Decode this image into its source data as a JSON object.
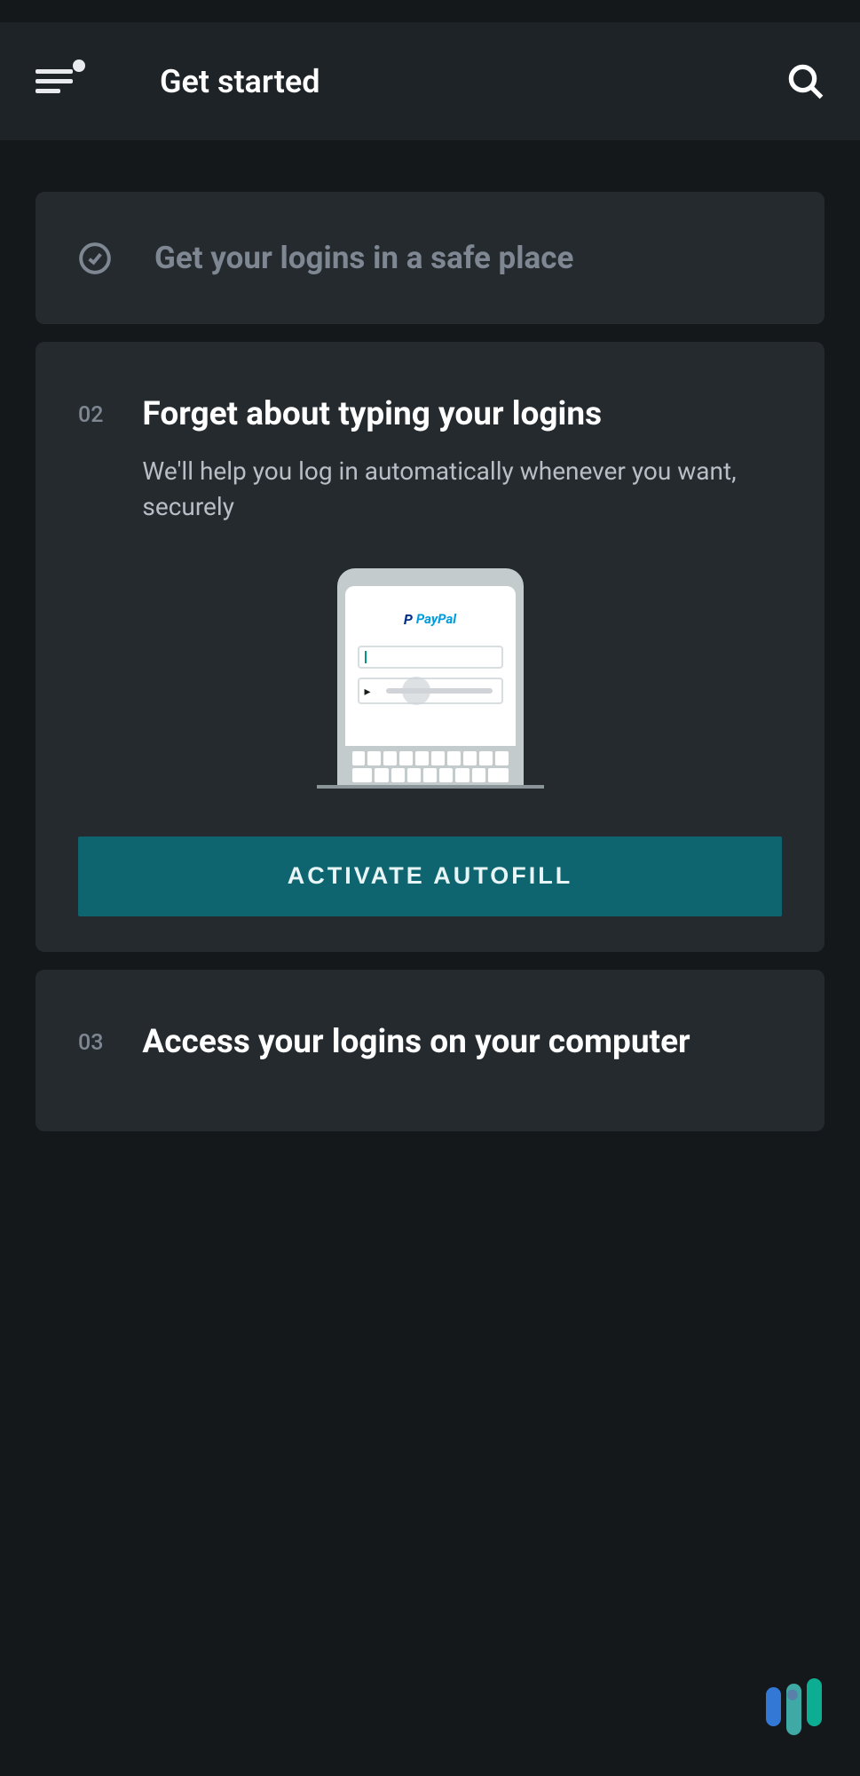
{
  "header": {
    "title": "Get started"
  },
  "steps": {
    "completed": {
      "title": "Get your logins in a safe place"
    },
    "active": {
      "number": "02",
      "title": "Forget about typing your logins",
      "subtitle": "We'll help you log in automatically whenever you want, securely",
      "button_label": "ACTIVATE AUTOFILL",
      "illustration_brand": "PayPal"
    },
    "next": {
      "number": "03",
      "title": "Access your logins on your computer"
    }
  }
}
